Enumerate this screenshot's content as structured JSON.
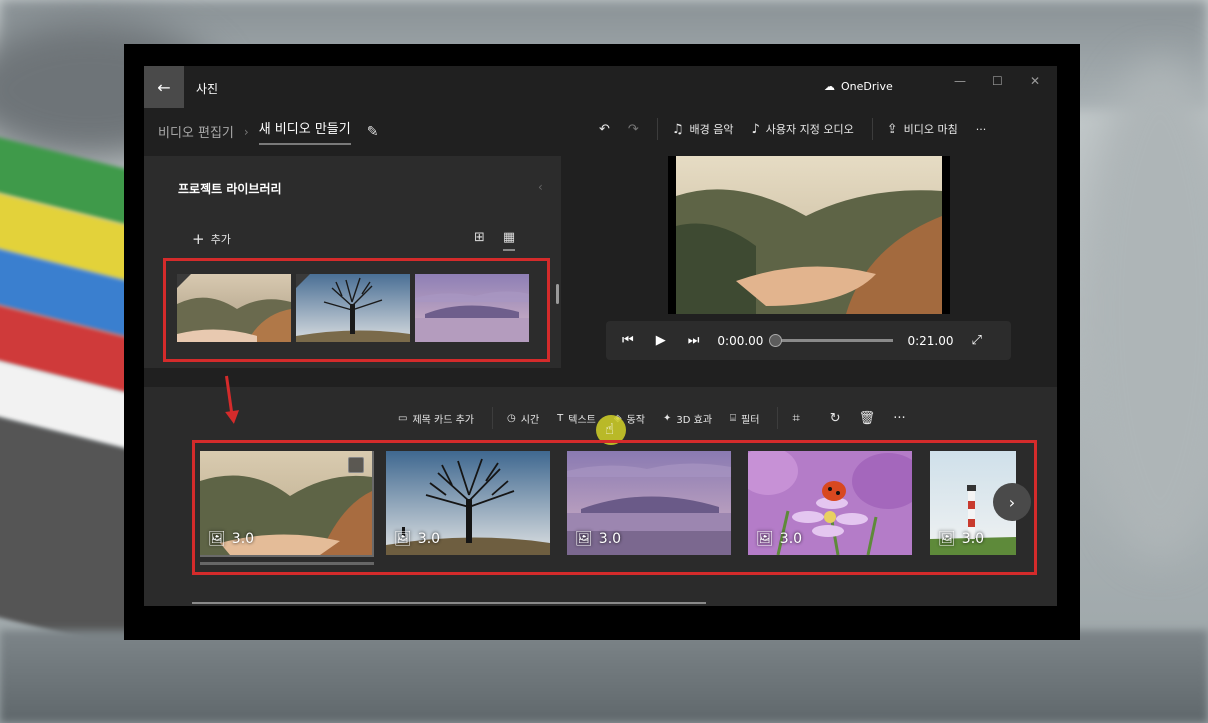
{
  "window": {
    "app_title": "사진",
    "onedrive_label": "OneDrive",
    "controls": {
      "minimize": "—",
      "maximize": "☐",
      "close": "✕"
    }
  },
  "breadcrumb": {
    "parent": "비디오 편집기",
    "separator": "›",
    "current": "새 비디오 만들기"
  },
  "top_toolbar": {
    "background_music": "배경 음악",
    "custom_audio": "사용자 지정 오디오",
    "finish_video": "비디오 마침",
    "more": "···"
  },
  "library": {
    "title": "프로젝트 라이브러리",
    "add_label": "추가",
    "thumbnails": [
      "landscape",
      "tree",
      "mountain"
    ]
  },
  "player": {
    "current_time": "0:00.00",
    "total_time": "0:21.00",
    "progress": 0.0
  },
  "storyboard_toolbar": {
    "title_card": "제목 카드 추가",
    "duration": "시간",
    "text": "텍스트",
    "motion": "동작",
    "effects_3d": "3D 효과",
    "filters": "필터",
    "more": "···"
  },
  "clips": [
    {
      "duration": "3.0",
      "image": "landscape"
    },
    {
      "duration": "3.0",
      "image": "tree"
    },
    {
      "duration": "3.0",
      "image": "mountain"
    },
    {
      "duration": "3.0",
      "image": "ladybug"
    },
    {
      "duration": "3.0",
      "image": "lighthouse"
    }
  ],
  "colors": {
    "annotation_red": "#d42b2b",
    "window_bg": "#202020",
    "panel_bg": "#2b2b2b",
    "cursor_highlight": "#d2d228"
  }
}
